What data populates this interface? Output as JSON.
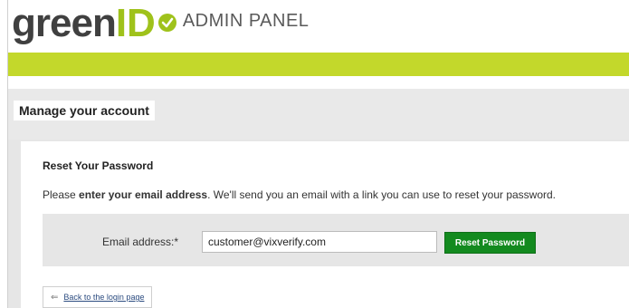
{
  "header": {
    "logo_text": "green",
    "logo_id": "ID",
    "logo_subtitle": "ADMIN PANEL",
    "brand_green": "#9fc21b",
    "bar_color": "#c3d82b"
  },
  "page": {
    "title": "Manage your account"
  },
  "reset": {
    "heading": "Reset Your Password",
    "instruction_prefix": "Please ",
    "instruction_bold": "enter your email address",
    "instruction_suffix": ". We'll send you an email with a link you can use to reset your password.",
    "email_label": "Email address:*",
    "email_value": "customer@vixverify.com",
    "button_label": "Reset Password",
    "button_color": "#138a1f"
  },
  "back": {
    "icon": "arrow-left-icon",
    "label": "Back to the login page"
  }
}
